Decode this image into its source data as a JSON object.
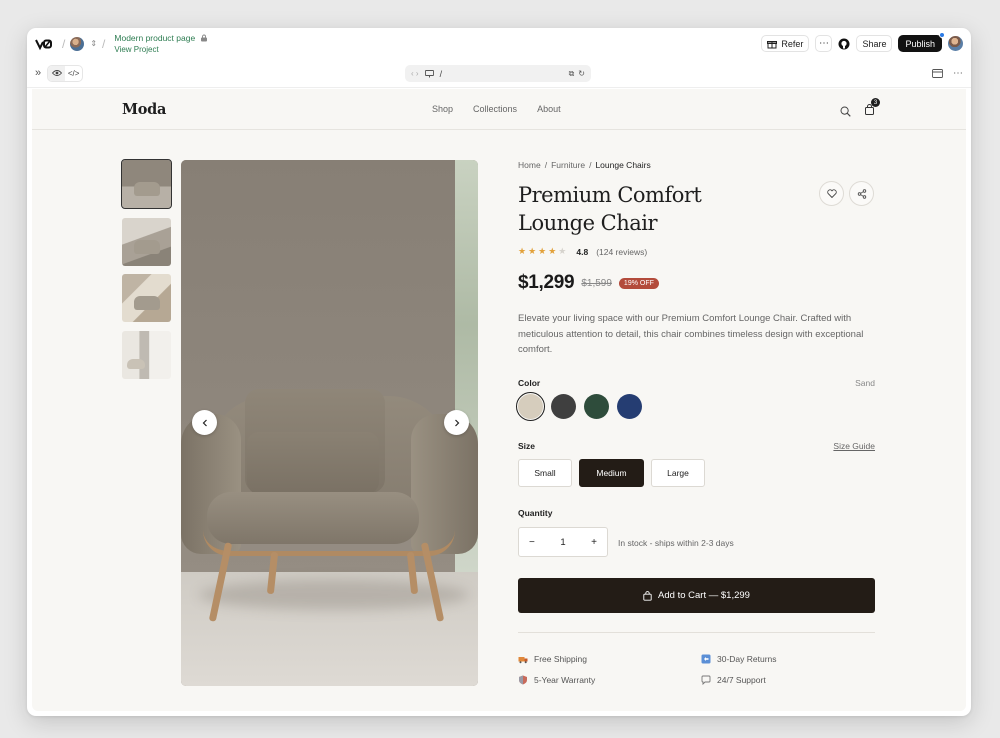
{
  "app": {
    "project_title": "Modern product page",
    "project_link": "View Project",
    "refer_label": "Refer",
    "share_label": "Share",
    "publish_label": "Publish"
  },
  "browser": {
    "url": "/"
  },
  "site": {
    "brand": "Moda",
    "nav": [
      "Shop",
      "Collections",
      "About"
    ],
    "cart_count": "3"
  },
  "product": {
    "breadcrumb": [
      "Home",
      "/",
      "Furniture",
      "/",
      "Lounge Chairs"
    ],
    "title": "Premium Comfort Lounge Chair",
    "stars": "★★★★",
    "star_empty": "★",
    "rating": "4.8",
    "reviews": "(124 reviews)",
    "price": "$1,299",
    "old_price": "$1,599",
    "discount": "19% OFF",
    "description": "Elevate your living space with our Premium Comfort Lounge Chair. Crafted with meticulous attention to detail, this chair combines timeless design with exceptional comfort.",
    "color_label": "Color",
    "color_selected": "Sand",
    "colors": [
      {
        "name": "Sand",
        "hex": "#d6cdbd"
      },
      {
        "name": "Charcoal",
        "hex": "#3f3f3f"
      },
      {
        "name": "Forest",
        "hex": "#2e4c3b"
      },
      {
        "name": "Navy",
        "hex": "#253d72"
      }
    ],
    "size_label": "Size",
    "size_guide": "Size Guide",
    "sizes": [
      "Small",
      "Medium",
      "Large"
    ],
    "size_selected": "Medium",
    "quantity_label": "Quantity",
    "quantity": "1",
    "qty_minus": "−",
    "qty_plus": "+",
    "stock": "In stock - ships within 2-3 days",
    "cart_button": "Add to Cart — $1,299",
    "features": [
      "Free Shipping",
      "30-Day Returns",
      "5-Year Warranty",
      "24/7 Support"
    ]
  }
}
